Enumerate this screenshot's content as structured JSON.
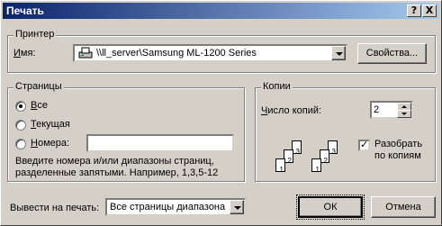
{
  "window": {
    "title": "Печать",
    "help_glyph": "?",
    "close_glyph": "X"
  },
  "printer": {
    "group_label": "Принтер",
    "name_label": "Имя:",
    "selected": "\\\\ll_server\\Samsung ML-1200 Series",
    "properties_button": "Свойства..."
  },
  "pages": {
    "group_label": "Страницы",
    "options": [
      "Все",
      "Текущая",
      "Номера:"
    ],
    "selected_index": 0,
    "numbers_value": "",
    "hint": "Введите номера и/или диапазоны страниц, разделенные запятыми. Например, 1,3,5-12"
  },
  "copies": {
    "group_label": "Копии",
    "count_label": "Число копий:",
    "count": "2",
    "collate_label": "Разобрать по копиям",
    "collate_checked": true,
    "collate_mark": "✓",
    "page_numbers": [
      "1",
      "2",
      "3"
    ]
  },
  "footer": {
    "print_label": "Вывести на печать:",
    "print_selected": "Все страницы диапазона",
    "ok_button": "ОК",
    "cancel_button": "Отмена"
  }
}
